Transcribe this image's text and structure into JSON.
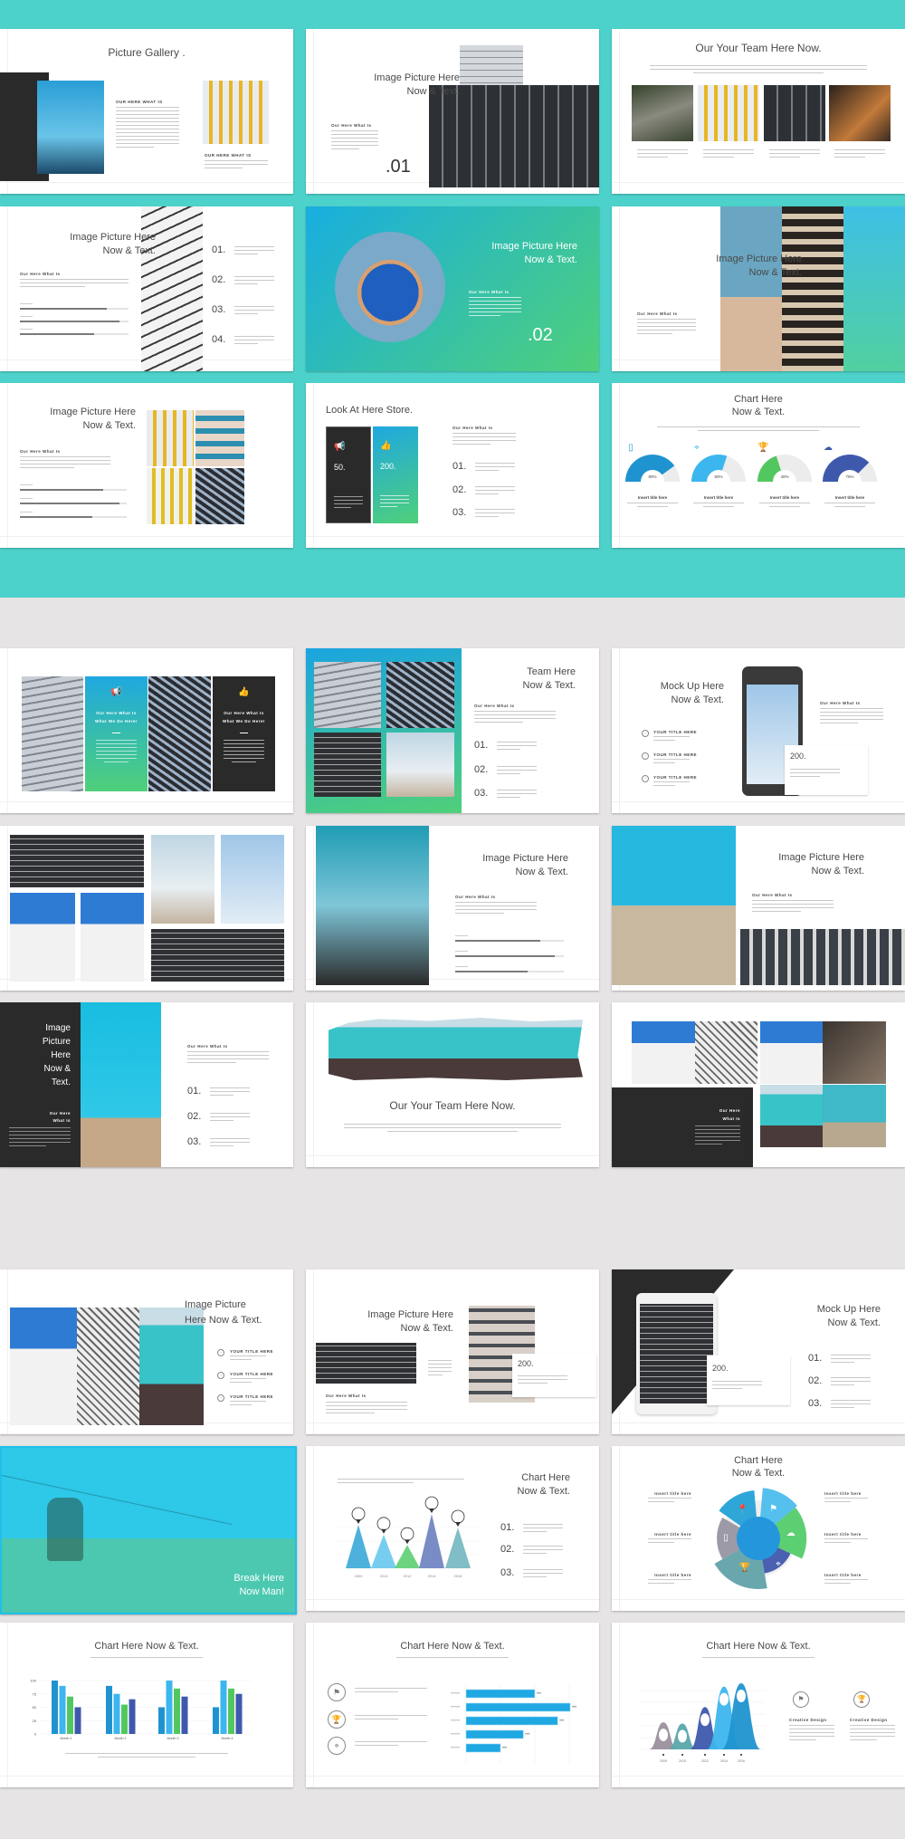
{
  "colors": {
    "band_top": "#4dd2cb",
    "band_bottom": "#e6e4e5",
    "accent_blue": "#1f93d0",
    "accent_light_blue": "#3cb6ee",
    "accent_green": "#53c75f",
    "accent_indigo": "#3e59ac",
    "dark_panel": "#2a2a2a"
  },
  "slides": [
    {
      "title": "Picture Gallery .",
      "labels": [
        "OUR HERE WHAT IS",
        "OUR HERE WHAT IS"
      ]
    },
    {
      "title_lines": [
        "Image Picture Here",
        "Now & Text."
      ],
      "label": "Our Here What Is",
      "number": ".01"
    },
    {
      "title": "Our Your Team Here Now."
    },
    {
      "title_lines": [
        "Image Picture Here",
        "Now & Text."
      ],
      "label": "Our Here What Is",
      "numbers": [
        "01.",
        "02.",
        "03.",
        "04."
      ],
      "progress": [
        0.8,
        0.92,
        0.68
      ]
    },
    {
      "title_lines": [
        "Image Picture Here",
        "Now & Text."
      ],
      "label": "Our Here What Is",
      "number": ".02"
    },
    {
      "title_lines": [
        "Image Picture Here",
        "Now & Text."
      ],
      "label": "Our Here What Is"
    },
    {
      "title_lines": [
        "Image Picture Here",
        "Now & Text."
      ],
      "label": "Our Here What Is",
      "progress": [
        0.78,
        0.93,
        0.68
      ]
    },
    {
      "title": "Look At Here Store.",
      "stats": [
        "50.",
        "200."
      ],
      "icons": [
        "megaphone-icon",
        "thumbs-up-icon"
      ],
      "label": "Our Here What Is",
      "numbers": [
        "01.",
        "02.",
        "03."
      ]
    },
    {
      "title_lines": [
        "Chart Here",
        "Now & Text."
      ],
      "gauges": [
        {
          "value": 80,
          "label": "80%",
          "caption": "Insert title here",
          "icon": "tablet-icon",
          "color": "#1f93d0"
        },
        {
          "value": 60,
          "label": "60%",
          "caption": "Insert title here",
          "icon": "map-pin-icon",
          "color": "#3cb6ee"
        },
        {
          "value": 40,
          "label": "40%",
          "caption": "Insert title here",
          "icon": "trophy-icon",
          "color": "#53c75f"
        },
        {
          "value": 75,
          "label": "75%",
          "caption": "Insert title here",
          "icon": "cloud-icon",
          "color": "#3e59ac"
        }
      ]
    },
    {
      "panel_lines": [
        "Our Here What Is",
        "What We Do Here!"
      ],
      "icons": [
        "megaphone-icon",
        "thumbs-up-icon"
      ]
    },
    {
      "title_lines": [
        "Team Here",
        "Now & Text."
      ],
      "label": "Our Here What Is",
      "numbers": [
        "01.",
        "02.",
        "03."
      ]
    },
    {
      "title_lines": [
        "Mock Up Here",
        "Now & Text."
      ],
      "items": [
        "YOUR TITLE HERE",
        "YOUR TITLE HERE",
        "YOUR TITLE HERE"
      ],
      "stat": "200.",
      "label": "Our Here What Is"
    },
    {},
    {
      "title_lines": [
        "Image Picture Here",
        "Now & Text."
      ],
      "label": "Our Here What Is",
      "progress": [
        0.78,
        0.92,
        0.67
      ]
    },
    {
      "title_lines": [
        "Image Picture Here",
        "Now & Text."
      ],
      "label": "Our Here What Is"
    },
    {
      "title_lines": [
        "Image",
        "Picture",
        "Here",
        "Now &",
        "Text."
      ],
      "label_lines": [
        "Our Here",
        "What Is"
      ],
      "label": "Our Here What Is",
      "numbers": [
        "01.",
        "02.",
        "03."
      ]
    },
    {
      "title": "Our Your Team Here Now."
    },
    {
      "label_lines": [
        "Our Here",
        "What Is"
      ]
    },
    {
      "title_lines": [
        "Image Picture",
        "Here Now & Text."
      ],
      "items": [
        "YOUR TITLE HERE",
        "YOUR TITLE HERE",
        "YOUR TITLE HERE"
      ]
    },
    {
      "title_lines": [
        "Image Picture Here",
        "Now & Text."
      ],
      "stat": "200.",
      "label": "Our Here What Is"
    },
    {
      "title_lines": [
        "Mock Up Here",
        "Now & Text."
      ],
      "stat": "200.",
      "numbers": [
        "01.",
        "02.",
        "03."
      ]
    },
    {
      "title_lines": [
        "Break Here",
        "Now Man!"
      ]
    },
    {
      "title_lines": [
        "Chart Here",
        "Now & Text."
      ],
      "numbers": [
        "01.",
        "02.",
        "03."
      ]
    },
    {
      "title_lines": [
        "Chart Here",
        "Now & Text."
      ],
      "captions": [
        "Insert title here",
        "Insert title here",
        "Insert title here",
        "Insert title here",
        "Insert title here",
        "Insert title here"
      ]
    },
    {
      "title": "Chart Here Now & Text."
    },
    {
      "title": "Chart Here Now & Text.",
      "icons": [
        "flag-icon",
        "trophy-icon",
        "compass-icon"
      ]
    },
    {
      "title": "Chart Here Now & Text.",
      "captions": [
        "Creative Design",
        "Creative Design"
      ]
    }
  ],
  "chart_data": [
    {
      "type": "pie",
      "variant": "semicircle-gauges",
      "categories": [
        "Insert title here",
        "Insert title here",
        "Insert title here",
        "Insert title here"
      ],
      "values": [
        80,
        60,
        40,
        75
      ],
      "unit": "%"
    },
    {
      "type": "bar",
      "variant": "triangles-with-pins",
      "categories": [
        "2009",
        "2010",
        "2012",
        "2014",
        "2016"
      ],
      "values": [
        80,
        62,
        43,
        100,
        75
      ],
      "ylim": [
        0,
        100
      ]
    },
    {
      "type": "pie",
      "variant": "radial-petals",
      "categories": [
        "Insert title here",
        "Insert title here",
        "Insert title here",
        "Insert title here",
        "Insert title here",
        "Insert title here"
      ],
      "values": [
        95,
        100,
        95,
        70,
        100,
        82
      ]
    },
    {
      "type": "bar",
      "categories": [
        "Month 1",
        "Month 2",
        "Month 3",
        "Month 4"
      ],
      "series": [
        {
          "values": [
            100,
            90,
            50,
            50
          ],
          "color": "#1f93d0"
        },
        {
          "values": [
            90,
            75,
            100,
            100
          ],
          "color": "#3cb6ee"
        },
        {
          "values": [
            70,
            55,
            85,
            85
          ],
          "color": "#53c75f"
        },
        {
          "values": [
            50,
            65,
            70,
            75
          ],
          "color": "#3e59ac"
        }
      ],
      "yticks": [
        "0",
        "25",
        "50",
        "75",
        "100"
      ],
      "ylim": [
        0,
        100
      ],
      "grid": true
    },
    {
      "type": "bar",
      "orientation": "horizontal",
      "values": [
        66,
        100,
        88,
        55,
        33
      ],
      "xlim": [
        0,
        100
      ],
      "grid": true,
      "color": "#1fa8e2"
    },
    {
      "type": "area",
      "variant": "bell-peaks",
      "categories": [
        "2009",
        "2010",
        "2012",
        "2014",
        "2016"
      ],
      "values": [
        41,
        39,
        64,
        95,
        100
      ],
      "colors": [
        "#9b8f9e",
        "#5aa6ab",
        "#3e59ac",
        "#3cb6ee",
        "#1f93d0"
      ],
      "grid": true
    }
  ]
}
